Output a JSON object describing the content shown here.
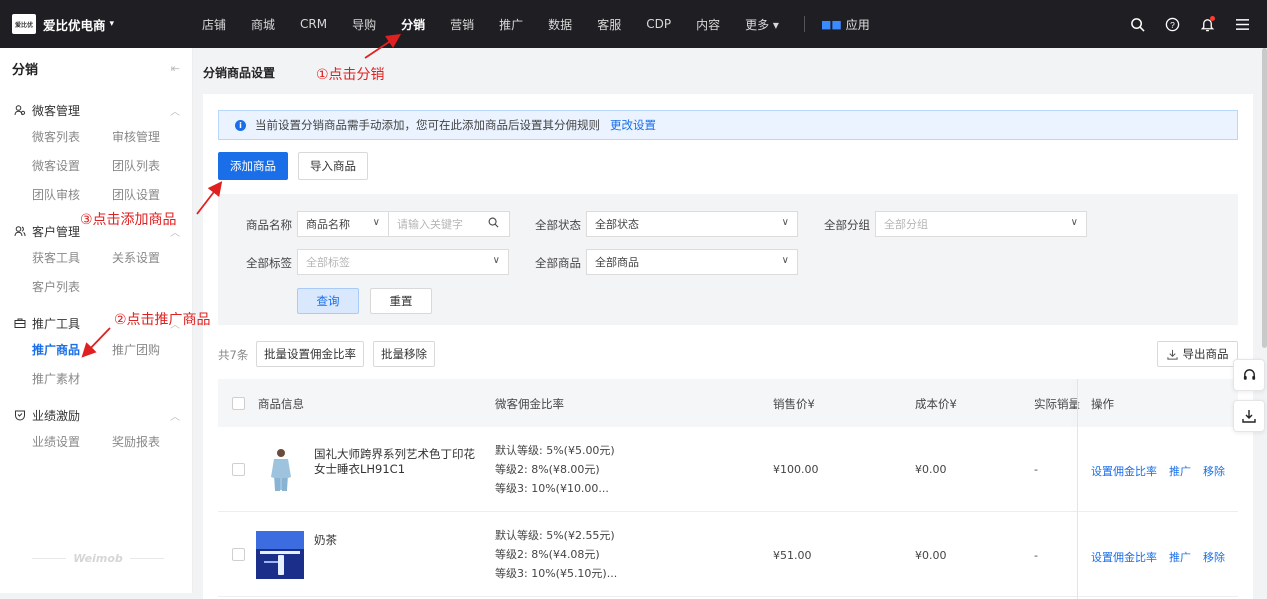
{
  "topbar": {
    "brand": "爱比优电商",
    "logo_text": "爱比优",
    "nav": [
      "店铺",
      "商城",
      "CRM",
      "导购",
      "分销",
      "营销",
      "推广",
      "数据",
      "客服",
      "CDP",
      "内容",
      "更多"
    ],
    "active_nav": "分销",
    "apps_label": "应用"
  },
  "sidebar": {
    "title": "分销",
    "groups": [
      {
        "label": "微客管理",
        "icon": "user-group-icon",
        "rows": [
          [
            "微客列表",
            "审核管理"
          ],
          [
            "微客设置",
            "团队列表"
          ],
          [
            "团队审核",
            "团队设置"
          ]
        ]
      },
      {
        "label": "客户管理",
        "icon": "customers-icon",
        "rows": [
          [
            "获客工具",
            "关系设置"
          ],
          [
            "客户列表"
          ]
        ]
      },
      {
        "label": "推广工具",
        "icon": "toolbox-icon",
        "rows": [
          [
            "推广商品",
            "推广团购"
          ],
          [
            "推广素材"
          ]
        ]
      },
      {
        "label": "业绩激励",
        "icon": "badge-icon",
        "rows": [
          [
            "业绩设置",
            "奖励报表"
          ]
        ]
      }
    ],
    "active_item": "推广商品",
    "footer": "Weimob"
  },
  "main": {
    "page_title": "分销商品设置",
    "notice_text": "当前设置分销商品需手动添加，您可在此添加商品后设置其分佣规则",
    "notice_link": "更改设置",
    "add_button": "添加商品",
    "import_button": "导入商品",
    "filters": {
      "name_label": "商品名称",
      "name_select": "商品名称",
      "keyword_placeholder": "请输入关键字",
      "status_label": "全部状态",
      "status_value": "全部状态",
      "group_label": "全部分组",
      "group_placeholder": "全部分组",
      "tag_label": "全部标签",
      "tag_placeholder": "全部标签",
      "goods_label": "全部商品",
      "goods_value": "全部商品",
      "query_button": "查询",
      "reset_button": "重置"
    },
    "total_text": "共7条",
    "batch_rate_button": "批量设置佣金比率",
    "batch_remove_button": "批量移除",
    "export_button": "导出商品",
    "table": {
      "columns": [
        "商品信息",
        "微客佣金比率",
        "销售价¥",
        "成本价¥",
        "实际销量",
        "操作"
      ],
      "rows": [
        {
          "name": "国礼大师跨界系列艺术色丁印花女士睡衣LH91C1",
          "rates": [
            "默认等级: 5%(¥5.00元)",
            "等级2: 8%(¥8.00元)",
            "等级3: 10%(¥10.00..."
          ],
          "price": "¥100.00",
          "cost": "¥0.00",
          "sales": "-",
          "ops": [
            "设置佣金比率",
            "推广",
            "移除"
          ]
        },
        {
          "name": "奶茶",
          "rates": [
            "默认等级: 5%(¥2.55元)",
            "等级2: 8%(¥4.08元)",
            "等级3: 10%(¥5.10元)..."
          ],
          "price": "¥51.00",
          "cost": "¥0.00",
          "sales": "-",
          "ops": [
            "设置佣金比率",
            "推广",
            "移除"
          ]
        }
      ]
    }
  },
  "annotations": {
    "step1": "①点击分销",
    "step2": "②点击推广商品",
    "step3": "③点击添加商品"
  },
  "colors": {
    "accent": "#1a6fe8",
    "topbar": "#1f1f23",
    "annotation": "#e02020"
  }
}
